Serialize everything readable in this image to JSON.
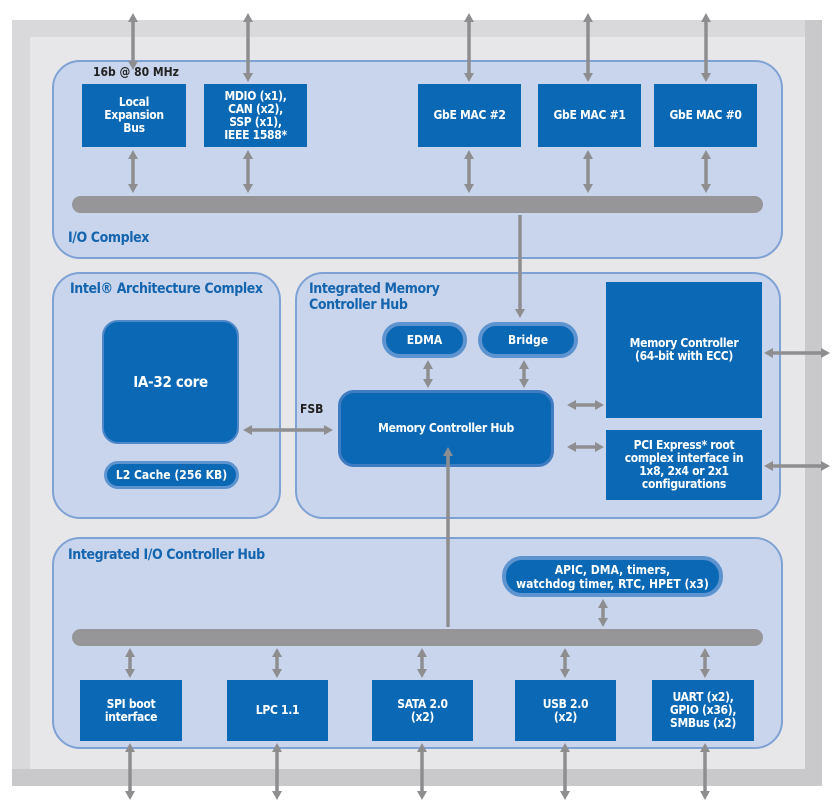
{
  "io_complex": {
    "title": "I/O Complex",
    "bus_note": "16b @ 80 MHz",
    "blocks": [
      "Local\nExpansion\nBus",
      "MDIO (x1),\nCAN (x2),\nSSP (x1),\nIEEE 1588*",
      "GbE MAC #2",
      "GbE MAC #1",
      "GbE MAC #0"
    ]
  },
  "ia_complex": {
    "title": "Intel® Architecture Complex",
    "core": "IA-32 core",
    "cache": "L2 Cache (256 KB)"
  },
  "fsb_label": "FSB",
  "imch": {
    "title": "Integrated Memory\nController Hub",
    "edma": "EDMA",
    "bridge": "Bridge",
    "hub": "Memory Controller Hub",
    "memory_controller": "Memory Controller\n(64-bit with ECC)",
    "pcie": "PCI Express* root\ncomplex interface in\n1x8, 2x4 or 2x1\nconfigurations"
  },
  "iich": {
    "title": "Integrated I/O Controller Hub",
    "timers": "APIC, DMA, timers,\nwatchdog timer, RTC, HPET (x3)",
    "blocks": [
      "SPI boot\ninterface",
      "LPC 1.1",
      "SATA 2.0\n(x2)",
      "USB 2.0\n(x2)",
      "UART (x2),\nGPIO (x36),\nSMBus (x2)"
    ]
  },
  "colors": {
    "block": "#0a68b4",
    "panel": "#c8d5ec",
    "panel_border": "#7fa2d4",
    "bus": "#969698",
    "label": "#1464ae"
  }
}
